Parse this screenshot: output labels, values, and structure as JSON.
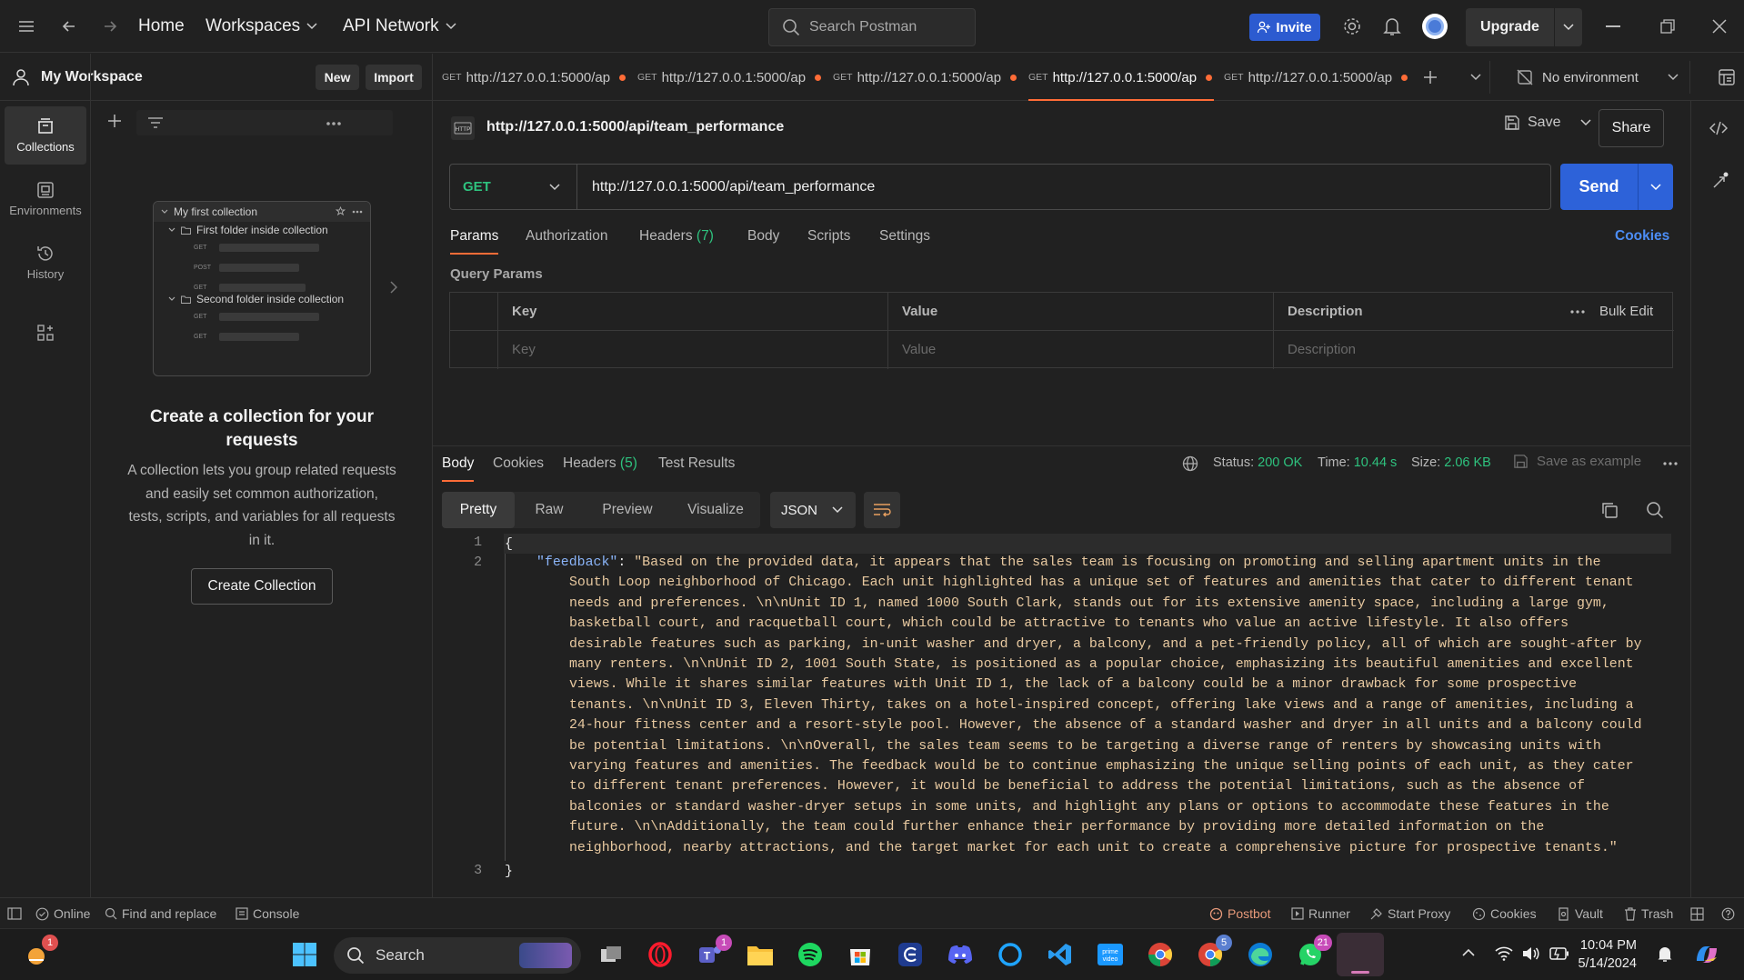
{
  "topbar": {
    "home": "Home",
    "workspaces": "Workspaces",
    "api_network": "API Network",
    "search_placeholder": "Search Postman",
    "invite": "Invite",
    "upgrade": "Upgrade"
  },
  "workspace": {
    "name": "My Workspace",
    "new_btn": "New",
    "import_btn": "Import"
  },
  "rail": [
    {
      "label": "Collections",
      "icon": "collections-icon"
    },
    {
      "label": "Environments",
      "icon": "environments-icon"
    },
    {
      "label": "History",
      "icon": "history-icon"
    }
  ],
  "preview": {
    "collection": "My first collection",
    "folder1": "First folder inside collection",
    "folder2": "Second folder inside collection",
    "methods": [
      "GET",
      "POST",
      "GET",
      "GET",
      "GET"
    ]
  },
  "empty": {
    "title": "Create a collection for your requests",
    "desc": "A collection lets you group related requests and easily set common authorization, tests, scripts, and variables for all requests in it.",
    "button": "Create Collection"
  },
  "tabs": [
    {
      "method": "GET",
      "url": "http://127.0.0.1:5000/ap"
    },
    {
      "method": "GET",
      "url": "http://127.0.0.1:5000/ap"
    },
    {
      "method": "GET",
      "url": "http://127.0.0.1:5000/ap"
    },
    {
      "method": "GET",
      "url": "http://127.0.0.1:5000/ap"
    },
    {
      "method": "GET",
      "url": "http://127.0.0.1:5000/ap"
    }
  ],
  "environment": "No environment",
  "request": {
    "title": "http://127.0.0.1:5000/api/team_performance",
    "save": "Save",
    "share": "Share",
    "method": "GET",
    "url": "http://127.0.0.1:5000/api/team_performance",
    "send": "Send",
    "subtabs": [
      "Params",
      "Authorization",
      "Headers",
      "Body",
      "Scripts",
      "Settings"
    ],
    "headers_count": "(7)",
    "cookies": "Cookies",
    "query_params": "Query Params",
    "cols": {
      "key": "Key",
      "value": "Value",
      "description": "Description",
      "bulk": "Bulk Edit"
    },
    "placeholders": {
      "key": "Key",
      "value": "Value",
      "description": "Description"
    }
  },
  "response": {
    "tabs": [
      "Body",
      "Cookies",
      "Headers",
      "Test Results"
    ],
    "headers_count": "(5)",
    "status_label": "Status:",
    "status": "200 OK",
    "time_label": "Time:",
    "time": "10.44 s",
    "size_label": "Size:",
    "size": "2.06 KB",
    "save_example": "Save as example",
    "formats": [
      "Pretty",
      "Raw",
      "Preview",
      "Visualize"
    ],
    "lang": "JSON",
    "line_numbers": [
      "1",
      "2",
      "3"
    ],
    "open_brace": "{",
    "close_brace": "}",
    "json_key": "\"feedback\"",
    "json_lines": [
      "\"Based on the provided data, it appears that the sales team is focusing on promoting and selling apartment units in the",
      "South Loop neighborhood of Chicago. Each unit highlighted has a unique set of features and amenities that cater to different tenant",
      "needs and preferences. \\n\\nUnit ID 1, named 1000 South Clark, stands out for its extensive amenity space, including a large gym,",
      "basketball court, and racquetball court, which could be attractive to tenants who value an active lifestyle. It also offers",
      "desirable features such as parking, in-unit washer and dryer, a balcony, and a pet-friendly policy, all of which are sought-after by",
      "many renters. \\n\\nUnit ID 2, 1001 South State, is positioned as a popular choice, emphasizing its beautiful amenities and excellent",
      "views. While it shares similar features with Unit ID 1, the lack of a balcony could be a minor drawback for some prospective",
      "tenants. \\n\\nUnit ID 3, Eleven Thirty, takes on a hotel-inspired concept, offering lake views and a range of amenities, including a",
      "24-hour fitness center and a resort-style pool. However, the absence of a standard washer and dryer in all units and a balcony could",
      "be potential limitations. \\n\\nOverall, the sales team seems to be targeting a diverse range of renters by showcasing units with",
      "varying features and amenities. The feedback would be to continue emphasizing the unique selling points of each unit, as they cater",
      "to different tenant preferences. However, it would be beneficial to address the potential limitations, such as the absence of",
      "balconies or standard washer-dryer setups in some units, and highlight any plans or options to accommodate these features in the",
      "future. \\n\\nAdditionally, the team could further enhance their performance by providing more detailed information on the",
      "neighborhood, nearby attractions, and the target market for each unit to create a comprehensive picture for prospective tenants.\""
    ]
  },
  "statusbar": {
    "online": "Online",
    "find": "Find and replace",
    "console": "Console",
    "postbot": "Postbot",
    "runner": "Runner",
    "proxy": "Start Proxy",
    "cookies": "Cookies",
    "vault": "Vault",
    "trash": "Trash"
  },
  "taskbar": {
    "search": "Search",
    "time": "10:04 PM",
    "date": "5/14/2024",
    "badges": {
      "weather": "1",
      "teams": "1",
      "chrome": "5",
      "whatsapp": "21"
    }
  },
  "colors": {
    "accent": "#ff6c37",
    "send": "#2d62d9",
    "get": "#2ec27e",
    "status_ok": "#2ec27e"
  }
}
